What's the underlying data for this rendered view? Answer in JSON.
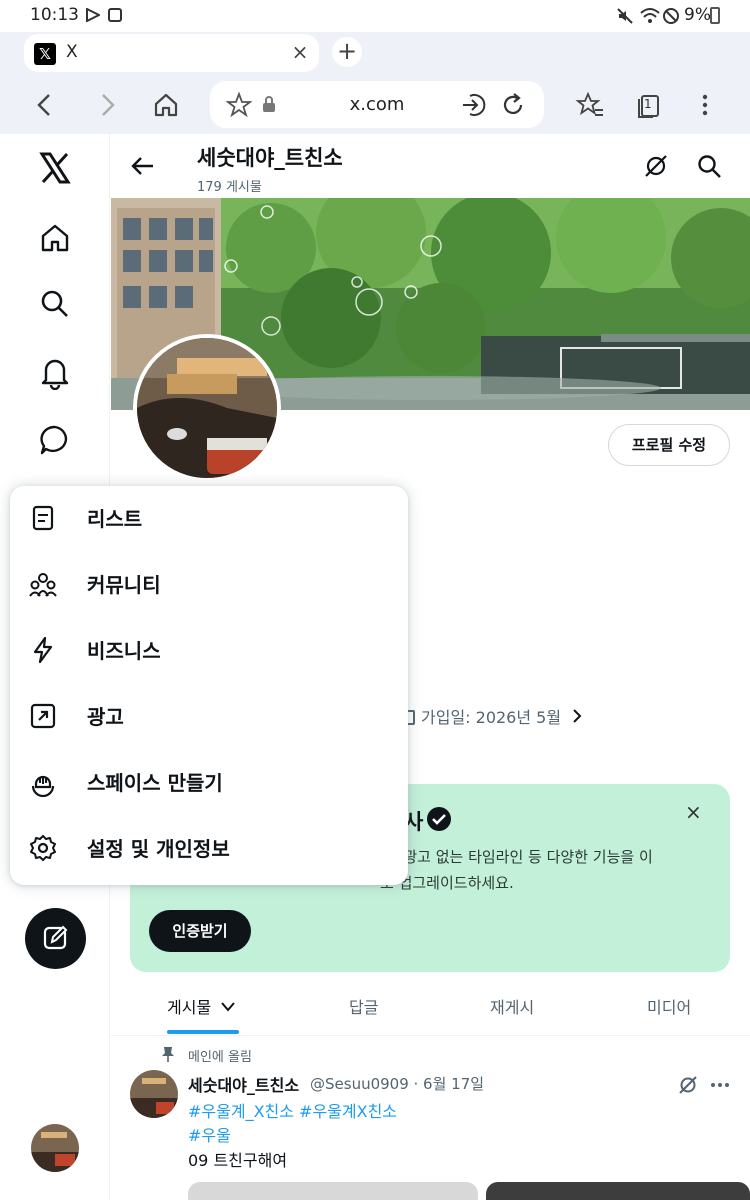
{
  "status_bar": {
    "time": "10:13",
    "battery": "9%"
  },
  "browser": {
    "tab_title": "X",
    "tab_close": "×",
    "new_tab": "+",
    "url": "x.com",
    "tab_count": "1"
  },
  "sidebar": {
    "items": [
      {
        "icon": "x-logo-icon"
      },
      {
        "icon": "home-icon"
      },
      {
        "icon": "search-icon"
      },
      {
        "icon": "bell-icon"
      },
      {
        "icon": "chat-icon"
      }
    ]
  },
  "profile": {
    "name": "세숫대야_트친소",
    "post_count": "179 게시물",
    "edit_button": "프로필 수정",
    "join_date": "가입일: 2026년 5월"
  },
  "premium": {
    "title": "사",
    "desc_line1": "스, 광고 없는 타임라인 등 다양한 기능을 이",
    "desc_line2": "로 업그레이드하세요.",
    "close": "×",
    "button": "인증받기"
  },
  "tabs": [
    {
      "label": "게시물"
    },
    {
      "label": "답글"
    },
    {
      "label": "재게시"
    },
    {
      "label": "미디어"
    }
  ],
  "tweet": {
    "pinned_label": "메인에 올림",
    "name": "세숫대야_트친소",
    "meta": "@Sesuu0909 · 6월 17일",
    "hashtags_line1": "#우울계_X친소 #우울계X친소",
    "hashtags_line2": "#우울",
    "text": "09 트친구해여"
  },
  "menu": {
    "items": [
      {
        "label": "리스트",
        "icon": "list-icon"
      },
      {
        "label": "커뮤니티",
        "icon": "community-icon"
      },
      {
        "label": "비즈니스",
        "icon": "lightning-icon"
      },
      {
        "label": "광고",
        "icon": "ads-icon"
      },
      {
        "label": "스페이스 만들기",
        "icon": "spaces-icon"
      },
      {
        "label": "설정 및 개인정보",
        "icon": "gear-icon"
      }
    ]
  },
  "colors": {
    "accent": "#1d9bf0",
    "premium_bg": "#c3f0d9",
    "dark": "#0f1419"
  }
}
